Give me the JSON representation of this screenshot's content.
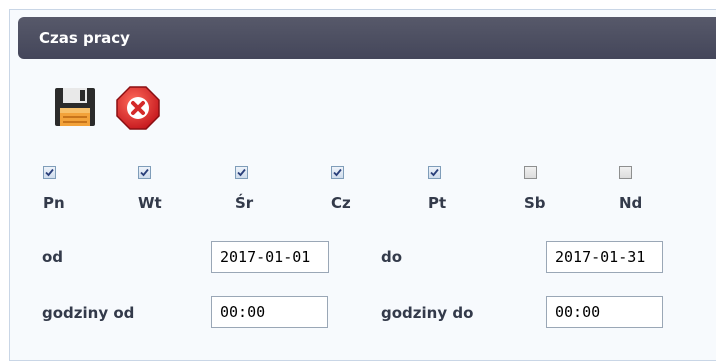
{
  "panel": {
    "title": "Czas pracy"
  },
  "toolbar": {
    "save_icon": "floppy-disk-icon",
    "cancel_icon": "red-octagon-x-icon"
  },
  "days": [
    {
      "label": "Pn",
      "checked": true
    },
    {
      "label": "Wt",
      "checked": true
    },
    {
      "label": "Śr",
      "checked": true
    },
    {
      "label": "Cz",
      "checked": true
    },
    {
      "label": "Pt",
      "checked": true
    },
    {
      "label": "Sb",
      "checked": false
    },
    {
      "label": "Nd",
      "checked": false
    }
  ],
  "form": {
    "od_label": "od",
    "od_value": "2017-01-01",
    "do_label": "do",
    "do_value": "2017-01-31",
    "godziny_od_label": "godziny od",
    "godziny_od_value": "00:00",
    "godziny_do_label": "godziny do",
    "godziny_do_value": "00:00"
  },
  "colors": {
    "titlebar": "#4a4c5f",
    "label": "#333a4a",
    "cancel": "#d42a2a"
  }
}
